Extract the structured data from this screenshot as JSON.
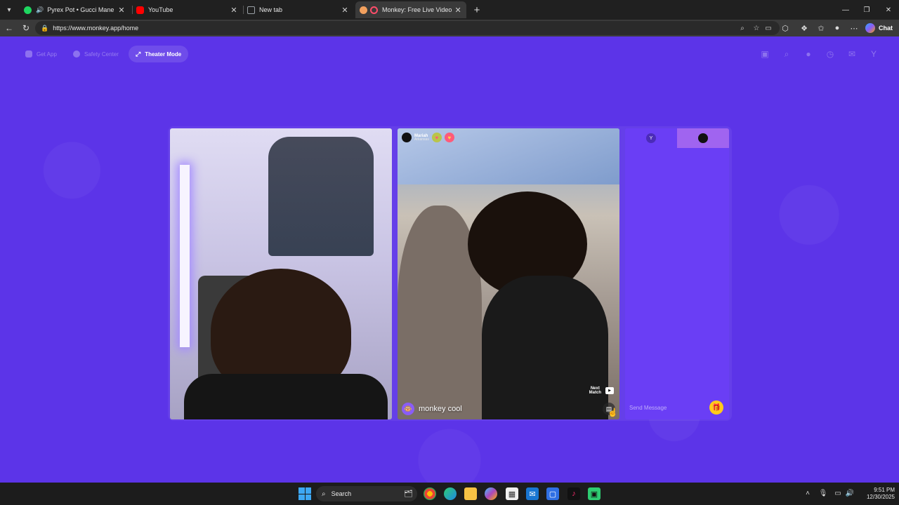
{
  "browser": {
    "tabs": [
      {
        "title": "Pyrex Pot • Gucci Mane",
        "favicon": "spotify-icon",
        "favicon_color": "#1ed760",
        "audio": true
      },
      {
        "title": "YouTube",
        "favicon": "youtube-icon",
        "favicon_color": "#ff0000"
      },
      {
        "title": "New tab",
        "favicon": "newtab-icon",
        "favicon_color": "#9aa0a6"
      },
      {
        "title": "Monkey: Free Live Video Chat",
        "favicon": "monkey-icon",
        "favicon_color": "#f2a05e",
        "active": true
      }
    ],
    "url": "https://www.monkey.app/home",
    "chat_label": "Chat"
  },
  "site": {
    "nav": {
      "get_app": "Get App",
      "safety_center": "Safety Center",
      "theater_mode": "Theater Mode"
    },
    "top_icons": [
      "shop-icon",
      "search-icon",
      "profile-icon",
      "history-icon",
      "messages-icon",
      "user-avatar-icon"
    ],
    "user_initial": "Y",
    "remote": {
      "name": "Mariah",
      "location": "Arkansas",
      "display_name": "monkey cool",
      "next_match_line1": "Next",
      "next_match_line2": "Match"
    },
    "chat": {
      "tab_initial": "Y",
      "placeholder": "Send Message"
    },
    "colors": {
      "background": "#5c34e8",
      "chat_panel": "#6a3ef5",
      "chat_tab_active": "#a064f0",
      "gift": "#ffca1a"
    }
  },
  "taskbar": {
    "search_label": "Search",
    "time": "9:51 PM",
    "date": "12/30/2025"
  }
}
